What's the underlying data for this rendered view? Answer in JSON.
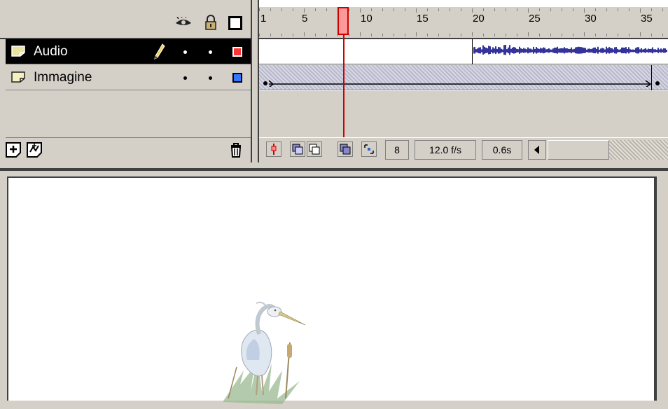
{
  "layers": {
    "header_icons": [
      "eye-icon",
      "lock-icon",
      "outline-icon"
    ],
    "items": [
      {
        "name": "Audio",
        "selected": true,
        "outline_color": "#ff3333",
        "pencil": true
      },
      {
        "name": "Immagine",
        "selected": false,
        "outline_color": "#3366ff",
        "pencil": false
      }
    ],
    "footer_icons": [
      "add-layer-icon",
      "add-motion-guide-icon",
      "delete-layer-icon"
    ]
  },
  "ruler": {
    "labels": [
      "1",
      "5",
      "10",
      "15",
      "20",
      "25",
      "30",
      "35"
    ],
    "current_frame_marker": 8
  },
  "status": {
    "current_frame": "8",
    "frame_rate": "12.0 f/s",
    "elapsed_time": "0.6s"
  },
  "colors": {
    "panel_bg": "#d4d0c8",
    "selected_row_bg": "#000000",
    "playhead": "#cc0000",
    "waveform": "#000080",
    "stage_bg": "#ffffff"
  }
}
